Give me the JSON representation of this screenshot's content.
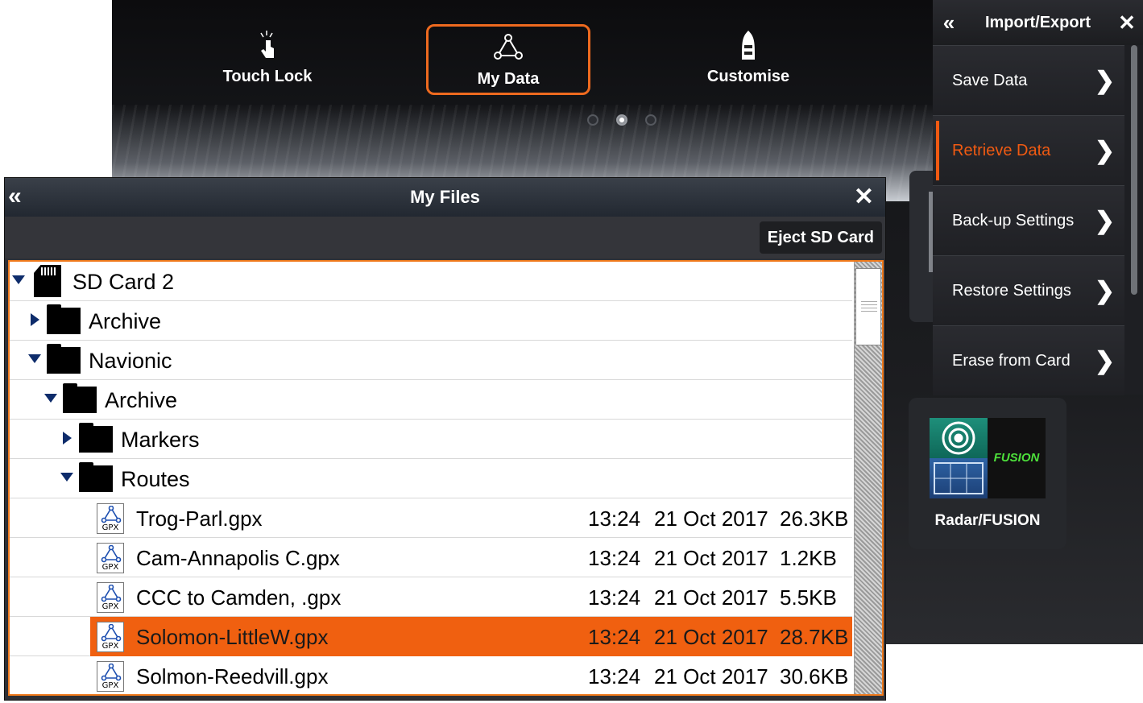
{
  "home": {
    "tiles": [
      {
        "label": "Touch Lock",
        "icon": "touch-lock-icon"
      },
      {
        "label": "My Data",
        "icon": "my-data-icon",
        "selected": true
      },
      {
        "label": "Customise",
        "icon": "boat-icon"
      }
    ],
    "page_dots": {
      "count": 3,
      "active": 2
    },
    "app_tile": {
      "label": "Radar/FUSION",
      "fusion_logo_text": "FUSION"
    }
  },
  "import_export": {
    "title": "Import/Export",
    "items": [
      {
        "label": "Save Data"
      },
      {
        "label": "Retrieve Data",
        "active": true
      },
      {
        "label": "Back-up Settings"
      },
      {
        "label": "Restore Settings"
      },
      {
        "label": "Erase from Card"
      }
    ]
  },
  "my_files": {
    "title": "My Files",
    "eject_label": "Eject SD Card",
    "tree": [
      {
        "label": "SD Card 2",
        "type": "card",
        "expanded": true
      },
      {
        "label": "Archive",
        "type": "folder",
        "expanded": false
      },
      {
        "label": "Navionic",
        "type": "folder",
        "expanded": true
      },
      {
        "label": "Archive",
        "type": "folder",
        "expanded": true
      },
      {
        "label": "Markers",
        "type": "folder",
        "expanded": false
      },
      {
        "label": "Routes",
        "type": "folder",
        "expanded": true
      }
    ],
    "files": [
      {
        "name": "Trog-Parl.gpx",
        "time": "13:24",
        "date": "21 Oct 2017",
        "size": "26.3KB"
      },
      {
        "name": "Cam-Annapolis C.gpx",
        "time": "13:24",
        "date": "21 Oct 2017",
        "size": "1.2KB"
      },
      {
        "name": "CCC to Camden, .gpx",
        "time": "13:24",
        "date": "21 Oct 2017",
        "size": "5.5KB"
      },
      {
        "name": "Solomon-LittleW.gpx",
        "time": "13:24",
        "date": "21 Oct 2017",
        "size": "28.7KB",
        "selected": true
      },
      {
        "name": "Solmon-Reedvill.gpx",
        "time": "13:24",
        "date": "21 Oct 2017",
        "size": "30.6KB"
      }
    ],
    "colors": {
      "accent": "#f06010",
      "tree_toggle": "#0e2c6b"
    }
  }
}
